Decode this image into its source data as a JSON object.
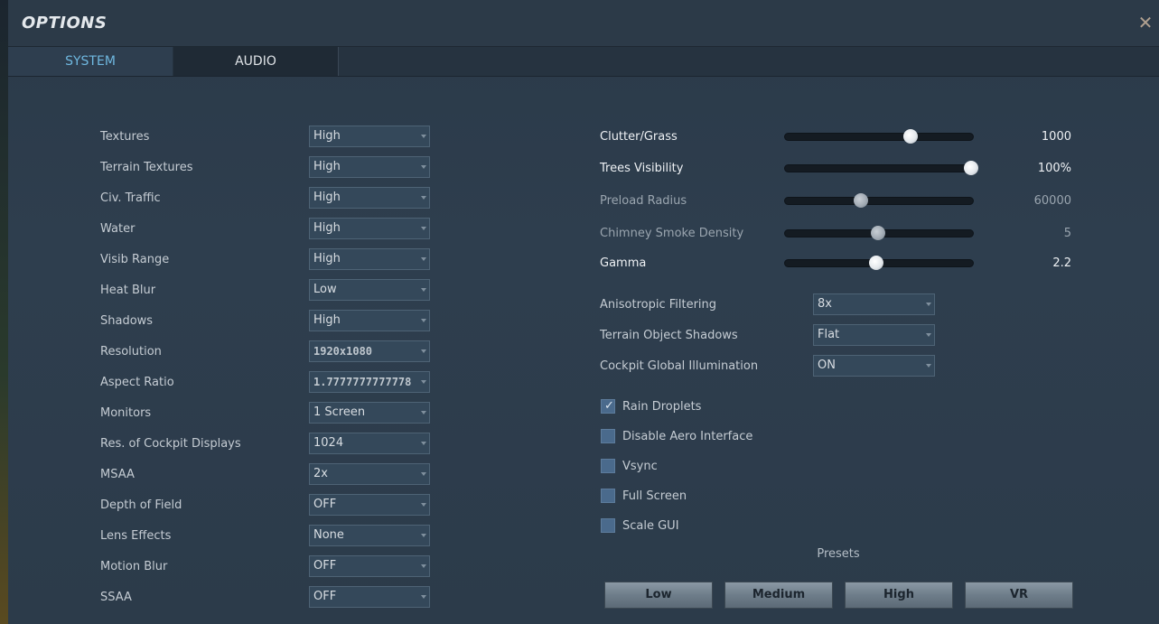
{
  "window": {
    "title": "OPTIONS",
    "close_glyph": "✕"
  },
  "tabs": [
    {
      "label": "SYSTEM",
      "active": true
    },
    {
      "label": "AUDIO",
      "active": false
    }
  ],
  "left_settings": [
    {
      "label": "Textures",
      "value": "High"
    },
    {
      "label": "Terrain Textures",
      "value": "High"
    },
    {
      "label": "Civ. Traffic",
      "value": "High"
    },
    {
      "label": "Water",
      "value": "High"
    },
    {
      "label": "Visib Range",
      "value": "High"
    },
    {
      "label": "Heat Blur",
      "value": "Low"
    },
    {
      "label": "Shadows",
      "value": "High"
    },
    {
      "label": "Resolution",
      "value": "1920x1080"
    },
    {
      "label": "Aspect Ratio",
      "value": "1.7777777777778"
    },
    {
      "label": "Monitors",
      "value": "1 Screen"
    },
    {
      "label": "Res. of Cockpit Displays",
      "value": "1024"
    },
    {
      "label": "MSAA",
      "value": "2x"
    },
    {
      "label": "Depth of Field",
      "value": "OFF"
    },
    {
      "label": "Lens Effects",
      "value": "None"
    },
    {
      "label": "Motion Blur",
      "value": "OFF"
    },
    {
      "label": "SSAA",
      "value": "OFF"
    }
  ],
  "sliders": [
    {
      "label": "Clutter/Grass",
      "value": "1000",
      "fraction": 0.66,
      "enabled": true
    },
    {
      "label": "Trees Visibility",
      "value": "100%",
      "fraction": 0.98,
      "enabled": true
    },
    {
      "label": "Preload Radius",
      "value": "60000",
      "fraction": 0.4,
      "enabled": false
    },
    {
      "label": "Chimney Smoke Density",
      "value": "5",
      "fraction": 0.49,
      "enabled": false
    },
    {
      "label": "Gamma",
      "value": "2.2",
      "fraction": 0.48,
      "enabled": true
    }
  ],
  "right_settings": [
    {
      "label": "Anisotropic Filtering",
      "value": "8x"
    },
    {
      "label": "Terrain Object Shadows",
      "value": "Flat"
    },
    {
      "label": "Cockpit Global Illumination",
      "value": "ON"
    }
  ],
  "checkboxes": [
    {
      "label": "Rain Droplets",
      "checked": true
    },
    {
      "label": "Disable Aero Interface",
      "checked": false
    },
    {
      "label": "Vsync",
      "checked": false
    },
    {
      "label": "Full Screen",
      "checked": false
    },
    {
      "label": "Scale GUI",
      "checked": false
    }
  ],
  "presets": {
    "label": "Presets",
    "buttons": [
      "Low",
      "Medium",
      "High",
      "VR"
    ]
  }
}
